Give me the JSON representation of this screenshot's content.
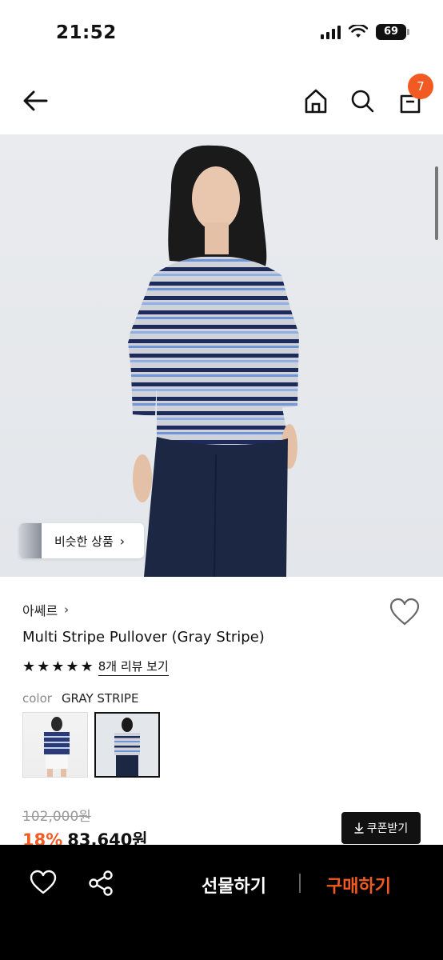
{
  "status_bar": {
    "time": "21:52",
    "battery": "69"
  },
  "nav": {
    "back_icon": "arrow-left-icon",
    "home_icon": "home-icon",
    "search_icon": "search-icon",
    "bag_icon": "shopping-bag-icon",
    "cart_count": "7"
  },
  "image": {
    "similar_label": "비슷한 상품",
    "similar_chevron": "›"
  },
  "product": {
    "brand": "아쎄르",
    "brand_chevron": "›",
    "title": "Multi Stripe Pullover (Gray Stripe)",
    "rating": 5,
    "review_link": "8개 리뷰 보기",
    "color_label": "color",
    "color_value": "GRAY STRIPE",
    "swatches": [
      "navy-stripe",
      "gray-stripe"
    ],
    "original_price": "102,000원",
    "discount": "18%",
    "sale_price": "83,640원",
    "coupon_label": "쿠폰받기"
  },
  "bottom_bar": {
    "gift_label": "선물하기",
    "buy_label": "구매하기"
  },
  "colors": {
    "accent": "#f15a22",
    "black": "#000000"
  }
}
